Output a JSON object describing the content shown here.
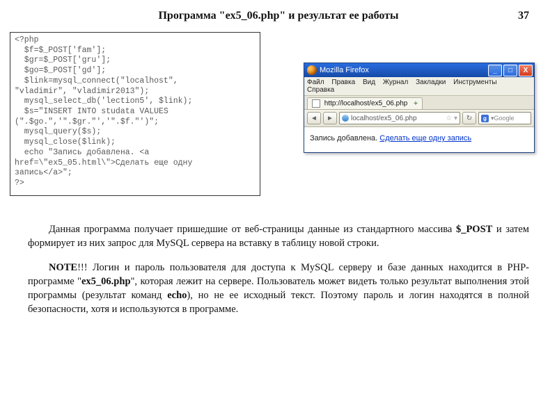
{
  "header": {
    "title": "Программа \"ex5_06.php\" и  результат  ее  работы",
    "page_number": "37"
  },
  "code": "<?php\n  $f=$_POST['fam'];\n  $gr=$_POST['gru'];\n  $go=$_POST['gd'];\n  $link=mysql_connect(\"localhost\",\n\"vladimir\", \"vladimir2013\");\n  mysql_select_db('lection5', $link);\n  $s=\"INSERT INTO studata VALUES\n(\".$go.\",'\".$gr.\"','\".$f.\"')\";\n  mysql_query($s);\n  mysql_close($link);\n  echo \"Запись добавлена. <a\nhref=\\\"ex5_05.html\\\">Сделать еще одну\nзапись</a>\";\n?>",
  "browser": {
    "title": "Mozilla Firefox",
    "menu": {
      "file": "Файл",
      "edit": "Правка",
      "view": "Вид",
      "history": "Журнал",
      "bookmarks": "Закладки",
      "tools": "Инструменты",
      "help": "Справка"
    },
    "tab_label": "http://localhost/ex5_06.php",
    "url": "localhost/ex5_06.php",
    "search_placeholder": "Google",
    "page_text": "Запись добавлена. ",
    "page_link": "Сделать еще одну запись"
  },
  "para1": {
    "pre_bold": "Данная  программа  получает  пришедшие  от  веб-страницы  данные  из стандартного  массива ",
    "bold": "$_POST",
    "post_bold": " и затем формирует  из  них  запрос  для MySQL сервера  на  вставку  в  таблицу новой строки."
  },
  "para2": {
    "note": "NOTE",
    "t1": "!!! Логин  и  пароль  пользователя для  доступа  к MySQL серверу  и  базе данных  находится  в  PHP-программе  \"",
    "prog": "ex5_06.php",
    "t2": "\",  которая  лежит  на  сервере. Пользователь  может  видеть  только  результат  выполнения этой  программы (результат  команд ",
    "echo": "echo",
    "t3": "),  но  не  ее исходный  текст.  Поэтому  пароль  и  логин находятся  в полной безопасности, хотя и используются в программе."
  }
}
